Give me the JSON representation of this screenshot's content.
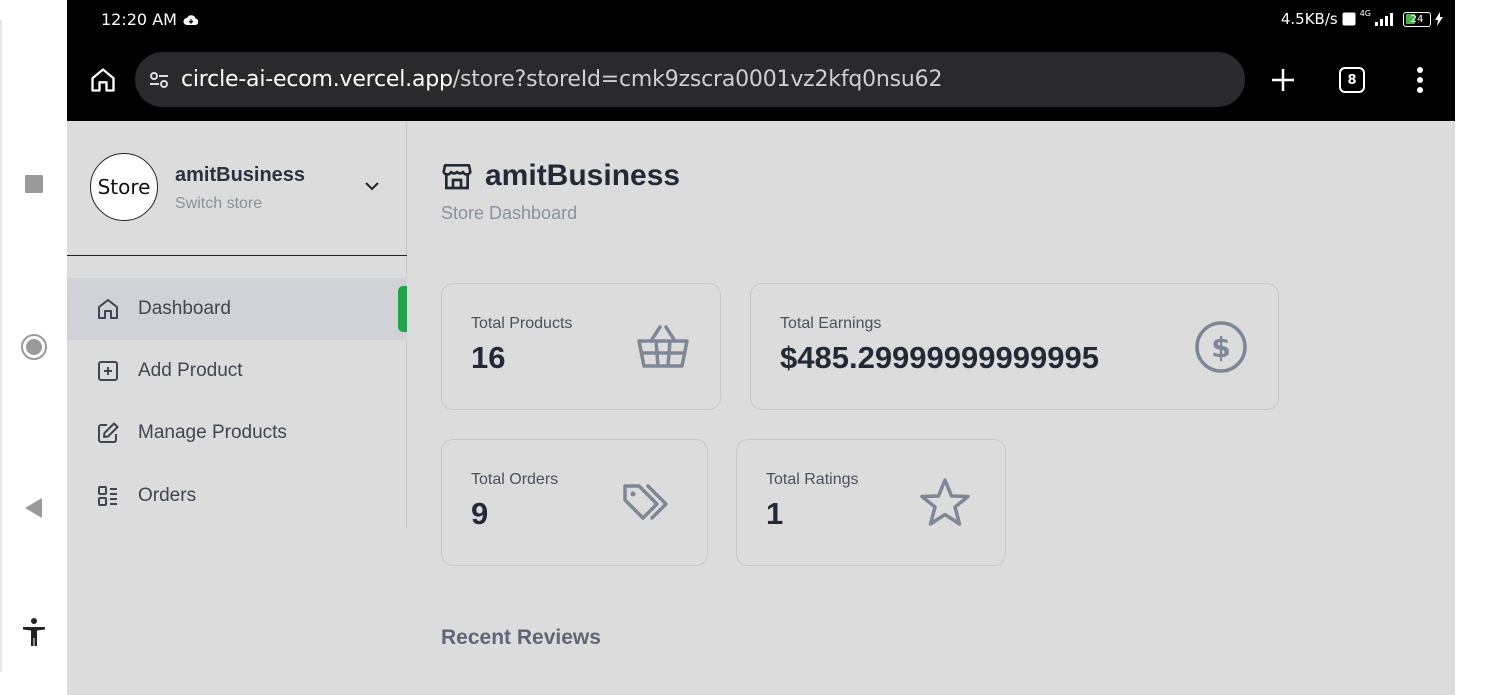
{
  "statusbar": {
    "time": "12:20 AM",
    "net_speed": "4.5KB/s",
    "signal": "4G",
    "battery": "24"
  },
  "browser": {
    "url_host": "circle-ai-ecom.vercel.app",
    "url_path": "/store?storeId=cmk9zscra0001vz2kfq0nsu62",
    "tab_count": "8"
  },
  "sidebar": {
    "store_avatar_text": "Store",
    "store_name": "amitBusiness",
    "switch_label": "Switch store",
    "items": [
      {
        "label": "Dashboard",
        "icon": "home-icon",
        "active": true
      },
      {
        "label": "Add Product",
        "icon": "plus-square-icon",
        "active": false
      },
      {
        "label": "Manage Products",
        "icon": "edit-icon",
        "active": false
      },
      {
        "label": "Orders",
        "icon": "list-icon",
        "active": false
      }
    ]
  },
  "main": {
    "title": "amitBusiness",
    "subtitle": "Store Dashboard",
    "stats": [
      {
        "label": "Total Products",
        "value": "16",
        "icon": "basket-icon"
      },
      {
        "label": "Total Earnings",
        "value": "$485.29999999999995",
        "icon": "dollar-circle-icon"
      },
      {
        "label": "Total Orders",
        "value": "9",
        "icon": "tags-icon"
      },
      {
        "label": "Total Ratings",
        "value": "1",
        "icon": "star-icon"
      }
    ],
    "recent_reviews_heading": "Recent Reviews"
  },
  "colors": {
    "accent_active": "#22a34a",
    "content_bg": "#dcdcdc",
    "text_primary": "#222a38",
    "text_muted": "#8892a2"
  }
}
